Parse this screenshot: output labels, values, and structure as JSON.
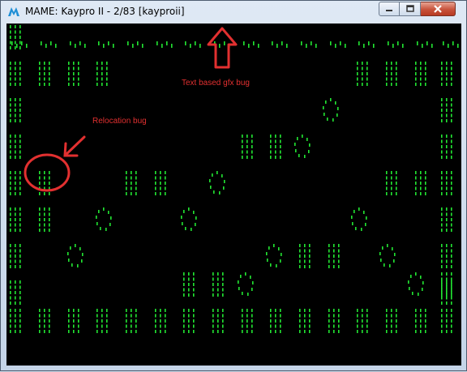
{
  "window": {
    "title": "MAME: Kaypro II - 2/83 [kayproii]",
    "app_icon": "mame-icon",
    "controls": [
      "minimize-icon",
      "maximize-icon",
      "close-icon"
    ]
  },
  "colors": {
    "phosphor": "#22e632",
    "annotation": "#e23030",
    "screen_bg": "#000000"
  },
  "annotations": {
    "text_gfx_bug": "Text based  gfx bug",
    "relocation_bug": "Relocation bug"
  }
}
